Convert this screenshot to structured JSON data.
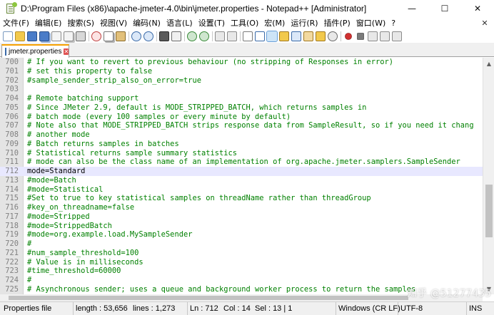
{
  "window": {
    "title": "D:\\Program Files (x86)\\apache-jmeter-4.0\\bin\\jmeter.properties - Notepad++ [Administrator]",
    "minimize_glyph": "—",
    "maximize_glyph": "☐",
    "close_glyph": "✕"
  },
  "menu": {
    "items": [
      "文件(F)",
      "编辑(E)",
      "搜索(S)",
      "视图(V)",
      "编码(N)",
      "语言(L)",
      "设置(T)",
      "工具(O)",
      "宏(M)",
      "运行(R)",
      "插件(P)",
      "窗口(W)",
      "?"
    ],
    "close_glyph": "✕"
  },
  "toolbar": {
    "icons": [
      "new-file-icon",
      "open-file-icon",
      "save-icon",
      "save-all-icon",
      "close-icon",
      "close-all-icon",
      "print-icon",
      "cut-icon",
      "copy-icon",
      "paste-icon",
      "undo-icon",
      "redo-icon",
      "find-icon",
      "replace-icon",
      "zoom-in-icon",
      "zoom-out-icon",
      "sync-vertical-icon",
      "sync-horizontal-icon",
      "word-wrap-icon",
      "show-all-chars-icon",
      "indent-guide-icon",
      "user-language-icon",
      "document-map-icon",
      "function-list-icon",
      "folder-workspace-icon",
      "monitoring-icon",
      "record-macro-icon",
      "stop-macro-icon",
      "play-macro-icon",
      "run-macro-multiple-icon",
      "save-macro-icon"
    ]
  },
  "tab": {
    "label": "jmeter.properties",
    "close_glyph": "✕"
  },
  "editor": {
    "current_line": 712,
    "lines": [
      {
        "num": "700",
        "text": "# If you want to revert to previous behaviour (no stripping of Responses in error)",
        "kind": "comment"
      },
      {
        "num": "701",
        "text": "# set this property to false",
        "kind": "comment"
      },
      {
        "num": "702",
        "text": "#sample_sender_strip_also_on_error=true",
        "kind": "comment"
      },
      {
        "num": "703",
        "text": "",
        "kind": "comment"
      },
      {
        "num": "704",
        "text": "# Remote batching support",
        "kind": "comment"
      },
      {
        "num": "705",
        "text": "# Since JMeter 2.9, default is MODE_STRIPPED_BATCH, which returns samples in",
        "kind": "comment"
      },
      {
        "num": "706",
        "text": "# batch mode (every 100 samples or every minute by default)",
        "kind": "comment"
      },
      {
        "num": "707",
        "text": "# Note also that MODE_STRIPPED_BATCH strips response data from SampleResult, so if you need it chang",
        "kind": "comment"
      },
      {
        "num": "708",
        "text": "# another mode",
        "kind": "comment"
      },
      {
        "num": "709",
        "text": "# Batch returns samples in batches",
        "kind": "comment"
      },
      {
        "num": "710",
        "text": "# Statistical returns sample summary statistics",
        "kind": "comment"
      },
      {
        "num": "711",
        "text": "# mode can also be the class name of an implementation of org.apache.jmeter.samplers.SampleSender",
        "kind": "comment"
      },
      {
        "num": "712",
        "key": "mode",
        "value": "Standard",
        "text": "mode=Standard",
        "kind": "key"
      },
      {
        "num": "713",
        "text": "#mode=Batch",
        "kind": "comment"
      },
      {
        "num": "714",
        "text": "#mode=Statistical",
        "kind": "comment"
      },
      {
        "num": "715",
        "text": "#Set to true to key statistical samples on threadName rather than threadGroup",
        "kind": "comment"
      },
      {
        "num": "716",
        "text": "#key_on_threadname=false",
        "kind": "comment"
      },
      {
        "num": "717",
        "text": "#mode=Stripped",
        "kind": "comment"
      },
      {
        "num": "718",
        "text": "#mode=StrippedBatch",
        "kind": "comment"
      },
      {
        "num": "719",
        "text": "#mode=org.example.load.MySampleSender",
        "kind": "comment"
      },
      {
        "num": "720",
        "text": "#",
        "kind": "comment"
      },
      {
        "num": "721",
        "text": "#num_sample_threshold=100",
        "kind": "comment"
      },
      {
        "num": "722",
        "text": "# Value is in milliseconds",
        "kind": "comment"
      },
      {
        "num": "723",
        "text": "#time_threshold=60000",
        "kind": "comment"
      },
      {
        "num": "724",
        "text": "#",
        "kind": "comment"
      },
      {
        "num": "725",
        "text": "# Asynchronous sender; uses a queue and background worker process to return the samples",
        "kind": "comment"
      }
    ]
  },
  "status": {
    "file_type": "Properties file",
    "length": "length : 53,656",
    "lines": "lines : 1,273",
    "ln": "Ln : 712",
    "col": "Col : 14",
    "sel": "Sel : 13 | 1",
    "eol": "Windows (CR LF)",
    "encoding": "UTF-8",
    "mode": "INS"
  },
  "watermark": "知乎 @51277435",
  "colors": {
    "comment": "#008000",
    "line_number": "#808080",
    "current_line_bg": "#e8e8ff",
    "gutter_bg": "#e4e4e4",
    "tab_accent": "#f6a000"
  }
}
